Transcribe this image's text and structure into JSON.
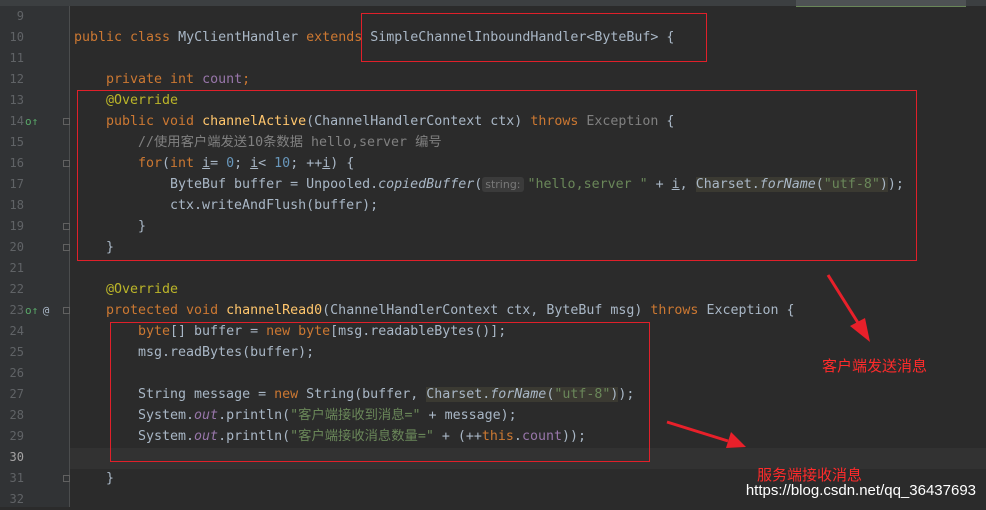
{
  "lines": [
    {
      "n": "9"
    },
    {
      "n": "10"
    },
    {
      "n": "11"
    },
    {
      "n": "12"
    },
    {
      "n": "13"
    },
    {
      "n": "14"
    },
    {
      "n": "15"
    },
    {
      "n": "16"
    },
    {
      "n": "17"
    },
    {
      "n": "18"
    },
    {
      "n": "19"
    },
    {
      "n": "20"
    },
    {
      "n": "21"
    },
    {
      "n": "22"
    },
    {
      "n": "23"
    },
    {
      "n": "24"
    },
    {
      "n": "25"
    },
    {
      "n": "26"
    },
    {
      "n": "27"
    },
    {
      "n": "28"
    },
    {
      "n": "29"
    },
    {
      "n": "30"
    },
    {
      "n": "31"
    },
    {
      "n": "32"
    }
  ],
  "code": {
    "l10": {
      "kw": "public class ",
      "cls": "MyClientHandler ",
      "ext": "extends ",
      "sup": "SimpleChannelInboundHandler<ByteBuf> {"
    },
    "l12": {
      "kw": "private int ",
      "field": "count",
      "end": ";"
    },
    "l13": {
      "ann": "@Override"
    },
    "l14": {
      "kw": "public void ",
      "fn": "channelActive",
      "args": "(ChannelHandlerContext ctx) ",
      "thr": "throws ",
      "exc": "Exception",
      "end": " {"
    },
    "l15": {
      "cmt": "//使用客户端发送10条数据 hello,server 编号"
    },
    "l16": {
      "kw1": "for",
      "p1": "(",
      "kw2": "int ",
      "v1": "i",
      "p2": "= ",
      "n0": "0",
      "p3": "; ",
      "v2": "i",
      "p4": "< ",
      "n10": "10",
      "p5": "; ++",
      "v3": "i",
      "p6": ") {"
    },
    "l17": {
      "a": "ByteBuf buffer = Unpooled.",
      "sfn": "copiedBuffer",
      "b": "(",
      "hint": "string:",
      "str": "\"hello,server \"",
      "c": " + ",
      "v": "i",
      "d": ", ",
      "cs1": "Charset.",
      "cs2": "forName",
      "cs3": "(",
      "cs4": "\"utf-8\"",
      "cs5": ")",
      "e": ");"
    },
    "l18": {
      "text": "ctx.writeAndFlush(buffer);"
    },
    "l19": {
      "text": "}"
    },
    "l20": {
      "text": "}"
    },
    "l22": {
      "ann": "@Override"
    },
    "l23": {
      "kw": "protected void ",
      "fn": "channelRead0",
      "args": "(ChannelHandlerContext ctx, ByteBuf msg) ",
      "thr": "throws ",
      "exc": "Exception {"
    },
    "l24": {
      "kw1": "byte",
      "a": "[] buffer = ",
      "kw2": "new ",
      "kw3": "byte",
      "b": "[msg.readableBytes()];"
    },
    "l25": {
      "text": "msg.readBytes(buffer);"
    },
    "l27": {
      "a": "String message = ",
      "kw": "new ",
      "b": "String(buffer, ",
      "cs1": "Charset.",
      "cs2": "forName",
      "cs3": "(",
      "cs4": "\"utf-8\"",
      "cs5": ")",
      "e": ");"
    },
    "l28": {
      "a": "System.",
      "out": "out",
      "b": ".println(",
      "str": "\"客户端接收到消息=\"",
      "c": " + message);"
    },
    "l29": {
      "a": "System.",
      "out": "out",
      "b": ".println(",
      "str": "\"客户端接收消息数量=\"",
      "c": " + (++",
      "kw": "this",
      "d": ".",
      "fld": "count",
      "e": "));"
    },
    "l31": {
      "text": "}"
    }
  },
  "annotations": {
    "client_send": "客户端发送消息",
    "server_recv": "服务端接收消息"
  },
  "watermark": "https://blog.csdn.net/qq_36437693",
  "colors": {
    "keyword": "#cc7832",
    "string": "#6a8759",
    "number": "#6897bb",
    "method": "#ffc66d",
    "annotation": "#bbb529",
    "comment": "#808080",
    "field": "#9876aa",
    "box": "#e0202a"
  },
  "icons": {
    "l14": "override-method-icon",
    "l23": "override-method-icon",
    "l23b": "at-annotation-icon"
  }
}
